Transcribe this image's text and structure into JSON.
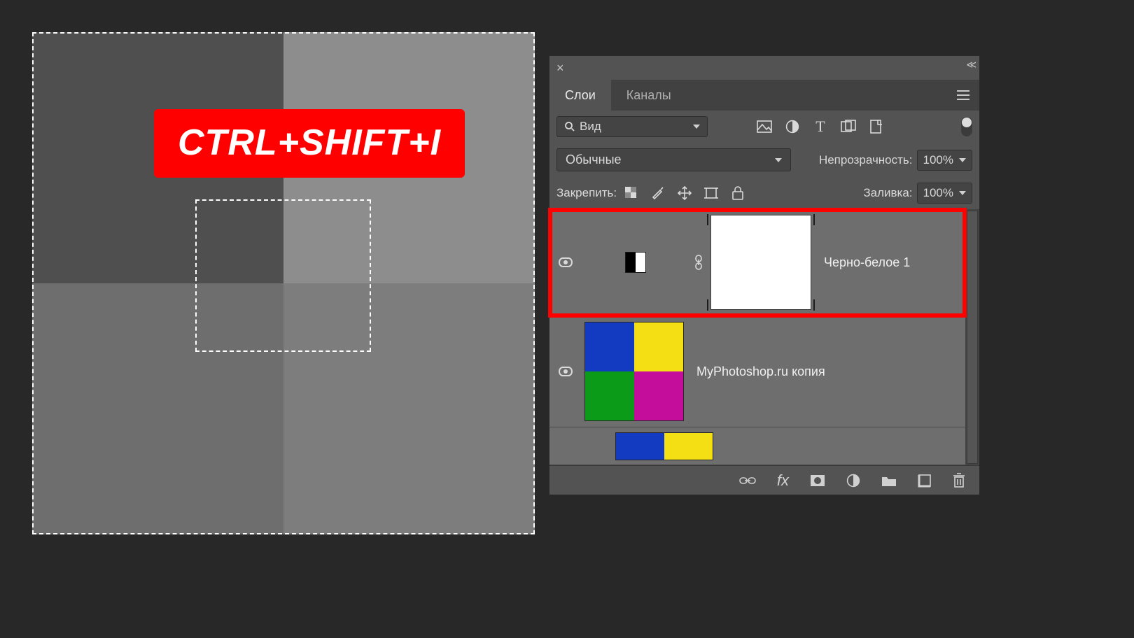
{
  "shortcut_overlay": "CTRL+SHIFT+I",
  "panel": {
    "tabs": {
      "layers": "Слои",
      "channels": "Каналы"
    },
    "filter_kind": "Вид",
    "blend_mode": "Обычные",
    "opacity_label": "Непрозрачность:",
    "opacity_value": "100%",
    "lock_label": "Закрепить:",
    "fill_label": "Заливка:",
    "fill_value": "100%"
  },
  "layers": {
    "adj_name": "Черно-белое 1",
    "layer2_name": "MyPhotoshop.ru копия"
  },
  "icon_names": {
    "image": "image-icon",
    "adjust": "adjust-circle-icon",
    "text": "text-icon",
    "shape": "shape-icon",
    "smart": "smart-object-icon",
    "lock_trans": "lock-transparency-icon",
    "brush": "brush-icon",
    "move": "move-icon",
    "artboard": "artboard-icon",
    "lock": "lock-icon"
  }
}
